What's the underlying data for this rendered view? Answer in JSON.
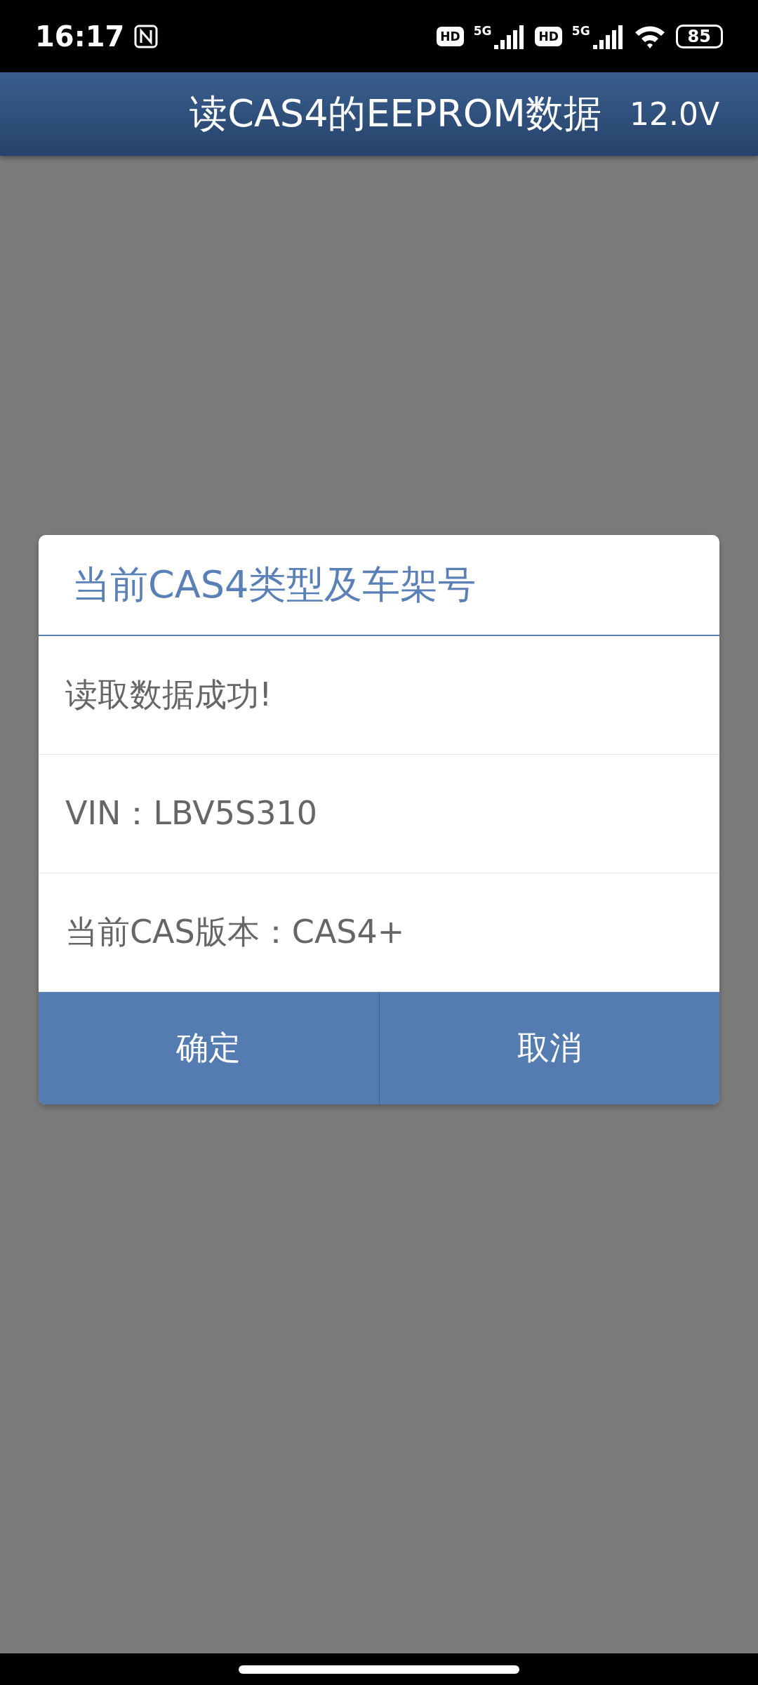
{
  "status_bar": {
    "time": "16:17",
    "hd_badges": [
      "HD",
      "HD"
    ],
    "network_labels": [
      "5G",
      "5G"
    ],
    "battery": "85"
  },
  "header": {
    "title": "读CAS4的EEPROM数据",
    "voltage": "12.0V"
  },
  "dialog": {
    "title": "当前CAS4类型及车架号",
    "rows": [
      {
        "text": "读取数据成功!"
      },
      {
        "text": "VIN：LBV5S310"
      },
      {
        "text": "当前CAS版本：CAS4+"
      }
    ],
    "buttons": [
      "确定",
      "取消"
    ]
  }
}
